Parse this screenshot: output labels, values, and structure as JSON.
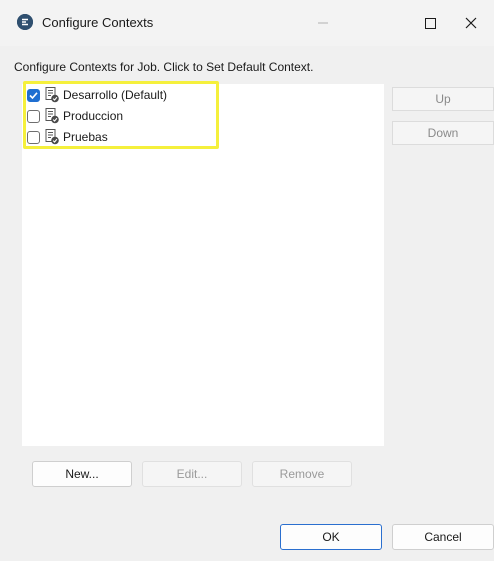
{
  "window": {
    "title": "Configure Contexts"
  },
  "instruction": "Configure Contexts for Job. Click to Set Default Context.",
  "contexts": [
    {
      "label": "Desarrollo (Default)",
      "checked": true
    },
    {
      "label": "Produccion",
      "checked": false
    },
    {
      "label": "Pruebas",
      "checked": false
    }
  ],
  "side_buttons": {
    "up": "Up",
    "down": "Down"
  },
  "list_buttons": {
    "new": "New...",
    "edit": "Edit...",
    "remove": "Remove"
  },
  "dialog_buttons": {
    "ok": "OK",
    "cancel": "Cancel"
  },
  "icons": {
    "app": "app-logo-icon",
    "minimize": "minimize-icon",
    "maximize": "maximize-icon",
    "close": "close-icon",
    "context": "context-document-icon",
    "checkmark": "checkmark-icon"
  },
  "colors": {
    "highlight": "#f5f03c",
    "checked_checkbox": "#1f6fd1",
    "default_button_border": "#2a6fcf"
  }
}
